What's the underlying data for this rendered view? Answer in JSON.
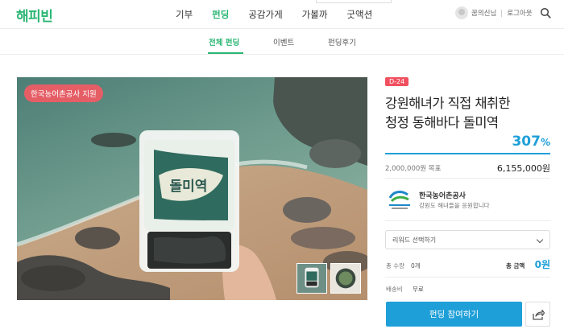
{
  "header": {
    "logo": "해피빈",
    "nav": [
      "기부",
      "펀딩",
      "공감가게",
      "가볼까",
      "굿액션"
    ],
    "active_nav_index": 1,
    "user_name": "꿈의신님",
    "logout": "로그아웃",
    "search_icon": "search-icon"
  },
  "subnav": {
    "items": [
      "전체 펀딩",
      "이벤트",
      "펀딩후기"
    ],
    "active_index": 0
  },
  "hero": {
    "support_badge": "한국농어촌공사 지원",
    "thumbnail_count": 2
  },
  "project": {
    "dday": "D-24",
    "title_line1": "강원해녀가 직접 채취한",
    "title_line2": "청정 동해바다 돌미역",
    "percent_number": "307",
    "percent_sign": "%",
    "progress_fraction": 1.0,
    "goal": "2,000,000원 목표",
    "raised": "6,155,000원"
  },
  "organization": {
    "name": "한국농어촌공사",
    "description": "강원도 해녀들을 응원합니다"
  },
  "order": {
    "reward_placeholder": "리워드 선택하기",
    "quantity_label": "총 수량",
    "quantity_value": "0개",
    "total_label": "총 금액",
    "total_value": "0원",
    "shipping_label": "배송비",
    "shipping_value": "무료",
    "cta": "펀딩 참여하기"
  },
  "colors": {
    "brand_green": "#2bb673",
    "accent_blue": "#1e9fd8",
    "dday_red": "#f0505f"
  }
}
